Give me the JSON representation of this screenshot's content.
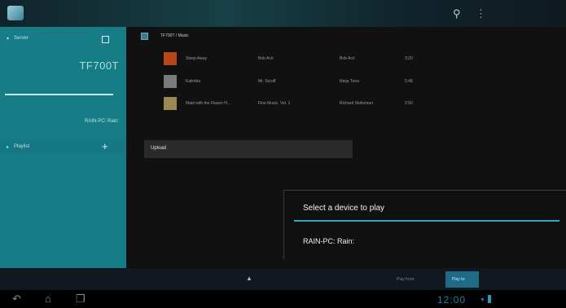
{
  "topbar": {
    "app_icon": "media-app-icon",
    "search_icon": "search-icon",
    "menu_icon": "overflow-menu-icon"
  },
  "sidebar": {
    "server_label": "Server",
    "server_icon": "square-icon",
    "device_name": "TF700T",
    "pc_name": "RAIN-PC: Rain:",
    "playlist_label": "Playlist",
    "add_icon": "plus-icon"
  },
  "main": {
    "breadcrumb": "TF700T / Music",
    "tracks": [
      {
        "title": "Sleep Away",
        "artist": "Bob Acri",
        "album": "Bob Acri",
        "duration": "3:20",
        "color": "#b5471a"
      },
      {
        "title": "Kalimba",
        "artist": "Mr. Scruff",
        "album": "Ninja Tuna",
        "duration": "5:48",
        "color": "#7a7a7a"
      },
      {
        "title": "Maid with the Flaxen H...",
        "artist": "Fine Music, Vol. 1",
        "album": "Richard Stoltzman",
        "duration": "2:50",
        "color": "#9a8a52"
      }
    ],
    "upload_label": "Upload"
  },
  "bottombar": {
    "play_from": "Play from:",
    "play_to": "Play to:"
  },
  "navbar": {
    "time": "12:00"
  },
  "dialog": {
    "title": "Select a device to play",
    "items": [
      "RAIN-PC: Rain:"
    ]
  },
  "colors": {
    "accent": "#36a3c6",
    "sidebar": "#167d87"
  }
}
